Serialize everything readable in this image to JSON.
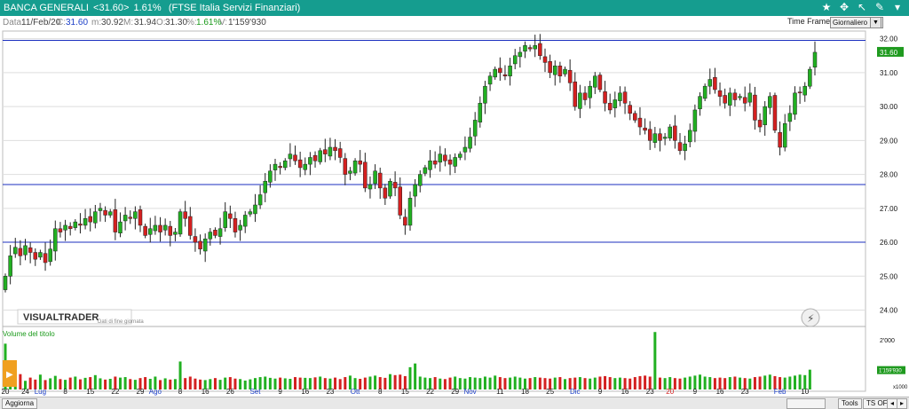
{
  "window": {
    "instrument": "BANCA GENERALI",
    "last_tag": "<31.60>",
    "change": "1.61%",
    "market": "(FTSE Italia Servizi Finanziari)"
  },
  "info": {
    "date_label": "Data:",
    "date_value": "11/Feb/20",
    "close_label": "C:",
    "close_value": "31.60",
    "low_label": "m:",
    "low_value": "30.92",
    "high_label": "M:",
    "high_value": "31.94",
    "open_label": "O:",
    "open_value": "31.30",
    "pct_label": "%:",
    "pct_value": "1.61%",
    "vol_label": "V:",
    "vol_value": "1'159'930"
  },
  "timeframe": {
    "label": "Time Frame",
    "selected": "Giornaliero"
  },
  "toolbar_icons": [
    "star-icon",
    "move-icon",
    "pointer-icon",
    "pencil-icon",
    "dropdown-icon"
  ],
  "watermark": {
    "brand": "VISUALTRADER",
    "note": "Dati di fine giornata"
  },
  "bottom": {
    "refresh": "Aggiorna",
    "tools": "Tools",
    "ts": "TS OFF",
    "nav_prev": "◂",
    "nav_next": "▸"
  },
  "colors": {
    "up": "#21b021",
    "down": "#d42020",
    "hline": "#1b2fbf",
    "title_bg": "#159d8f"
  },
  "chart_data": [
    {
      "type": "candlestick",
      "ylim": [
        23.7,
        32.2
      ],
      "yticks": [
        "24.00",
        "25.00",
        "26.00",
        "27.00",
        "28.00",
        "29.00",
        "30.00",
        "31.00",
        "32.00"
      ],
      "last_value_label": "31.60",
      "last_value": 31.6,
      "horizontal_lines": [
        31.95,
        27.7,
        26.0
      ],
      "grid": true,
      "xtick_labels": [
        {
          "label": "20",
          "idx": 0
        },
        {
          "label": "24",
          "idx": 4
        },
        {
          "label": "Lug",
          "idx": 7
        },
        {
          "label": "8",
          "idx": 12
        },
        {
          "label": "15",
          "idx": 17
        },
        {
          "label": "22",
          "idx": 22
        },
        {
          "label": "29",
          "idx": 27
        },
        {
          "label": "Ago",
          "idx": 30
        },
        {
          "label": "8",
          "idx": 35
        },
        {
          "label": "16",
          "idx": 40
        },
        {
          "label": "26",
          "idx": 45
        },
        {
          "label": "Set",
          "idx": 50
        },
        {
          "label": "9",
          "idx": 55
        },
        {
          "label": "16",
          "idx": 60
        },
        {
          "label": "23",
          "idx": 65
        },
        {
          "label": "Ott",
          "idx": 70
        },
        {
          "label": "8",
          "idx": 75
        },
        {
          "label": "15",
          "idx": 80
        },
        {
          "label": "22",
          "idx": 85
        },
        {
          "label": "29",
          "idx": 90
        },
        {
          "label": "Nov",
          "idx": 93
        },
        {
          "label": "11",
          "idx": 99
        },
        {
          "label": "18",
          "idx": 104
        },
        {
          "label": "25",
          "idx": 109
        },
        {
          "label": "Dic",
          "idx": 114
        },
        {
          "label": "9",
          "idx": 119
        },
        {
          "label": "16",
          "idx": 124
        },
        {
          "label": "23",
          "idx": 129
        },
        {
          "label": "20",
          "idx": 133
        },
        {
          "label": "9",
          "idx": 138
        },
        {
          "label": "16",
          "idx": 143
        },
        {
          "label": "23",
          "idx": 148
        },
        {
          "label": "Feb",
          "idx": 155
        },
        {
          "label": "10",
          "idx": 160
        }
      ],
      "red_tick_labels": [
        "20"
      ],
      "closes": [
        25.0,
        25.6,
        25.85,
        25.6,
        25.9,
        25.7,
        25.5,
        25.7,
        25.4,
        25.8,
        26.4,
        26.3,
        26.5,
        26.4,
        26.6,
        26.5,
        26.7,
        26.6,
        26.9,
        27.0,
        26.8,
        26.9,
        26.3,
        26.6,
        26.8,
        26.7,
        26.9,
        26.5,
        26.2,
        26.4,
        26.5,
        26.3,
        26.5,
        26.2,
        26.3,
        26.9,
        26.7,
        26.2,
        26.0,
        25.8,
        26.1,
        26.3,
        26.2,
        26.4,
        26.9,
        26.7,
        26.3,
        26.5,
        26.8,
        26.9,
        27.1,
        27.4,
        27.8,
        28.1,
        28.3,
        28.2,
        28.4,
        28.6,
        28.4,
        28.2,
        28.3,
        28.5,
        28.4,
        28.7,
        28.6,
        28.8,
        28.7,
        28.5,
        28.0,
        28.1,
        28.4,
        28.3,
        27.6,
        27.7,
        28.1,
        27.6,
        27.3,
        27.8,
        27.6,
        26.8,
        26.5,
        27.3,
        27.7,
        28.0,
        28.2,
        28.4,
        28.3,
        28.6,
        28.4,
        28.3,
        28.5,
        28.6,
        28.8,
        29.1,
        29.6,
        30.1,
        30.6,
        30.9,
        31.1,
        31.0,
        30.9,
        31.2,
        31.5,
        31.6,
        31.8,
        31.7,
        31.8,
        31.5,
        31.3,
        31.0,
        31.2,
        30.9,
        31.1,
        30.7,
        30.0,
        30.4,
        30.2,
        30.6,
        30.9,
        30.5,
        30.1,
        29.9,
        30.2,
        30.4,
        30.1,
        29.8,
        29.6,
        29.4,
        29.3,
        29.0,
        29.2,
        29.0,
        29.1,
        29.4,
        29.0,
        28.7,
        28.9,
        29.3,
        29.9,
        30.3,
        30.6,
        30.8,
        30.5,
        30.3,
        30.1,
        30.4,
        30.2,
        30.3,
        30.1,
        30.4,
        29.6,
        29.4,
        30.0,
        30.3,
        29.3,
        28.8,
        29.5,
        29.8,
        30.4,
        30.4,
        30.6,
        31.1,
        31.6
      ],
      "volume": {
        "label": "Volume del titolo",
        "unit": "x1000",
        "ytick": "2'000",
        "last_label": "1'159'930",
        "max": 2400,
        "values": [
          1850,
          420,
          300,
          620,
          350,
          480,
          400,
          600,
          380,
          450,
          550,
          420,
          390,
          480,
          520,
          410,
          470,
          500,
          580,
          450,
          400,
          430,
          520,
          480,
          500,
          420,
          390,
          460,
          500,
          430,
          520,
          380,
          450,
          400,
          420,
          1130,
          460,
          520,
          440,
          400,
          380,
          420,
          460,
          390,
          480,
          500,
          440,
          420,
          360,
          410,
          460,
          500,
          520,
          470,
          440,
          480,
          450,
          430,
          500,
          480,
          470,
          460,
          490,
          520,
          460,
          440,
          480,
          420,
          500,
          560,
          460,
          430,
          480,
          520,
          560,
          500,
          470,
          620,
          580,
          600,
          540,
          900,
          1050,
          520,
          480,
          460,
          500,
          440,
          420,
          480,
          520,
          460,
          440,
          500,
          480,
          460,
          520,
          480,
          560,
          500,
          460,
          480,
          520,
          480,
          440,
          460,
          500,
          480,
          460,
          440,
          480,
          500,
          420,
          460,
          480,
          500,
          460,
          440,
          480,
          520,
          540,
          500,
          460,
          480,
          460,
          440,
          500,
          540,
          560,
          520,
          2320,
          480,
          460,
          500,
          460,
          440,
          480,
          520,
          560,
          600,
          520,
          500,
          460,
          480,
          460,
          500,
          520,
          480,
          460,
          440,
          500,
          520,
          560,
          600,
          540,
          500,
          480,
          520,
          560,
          600,
          580,
          800
        ]
      }
    }
  ]
}
